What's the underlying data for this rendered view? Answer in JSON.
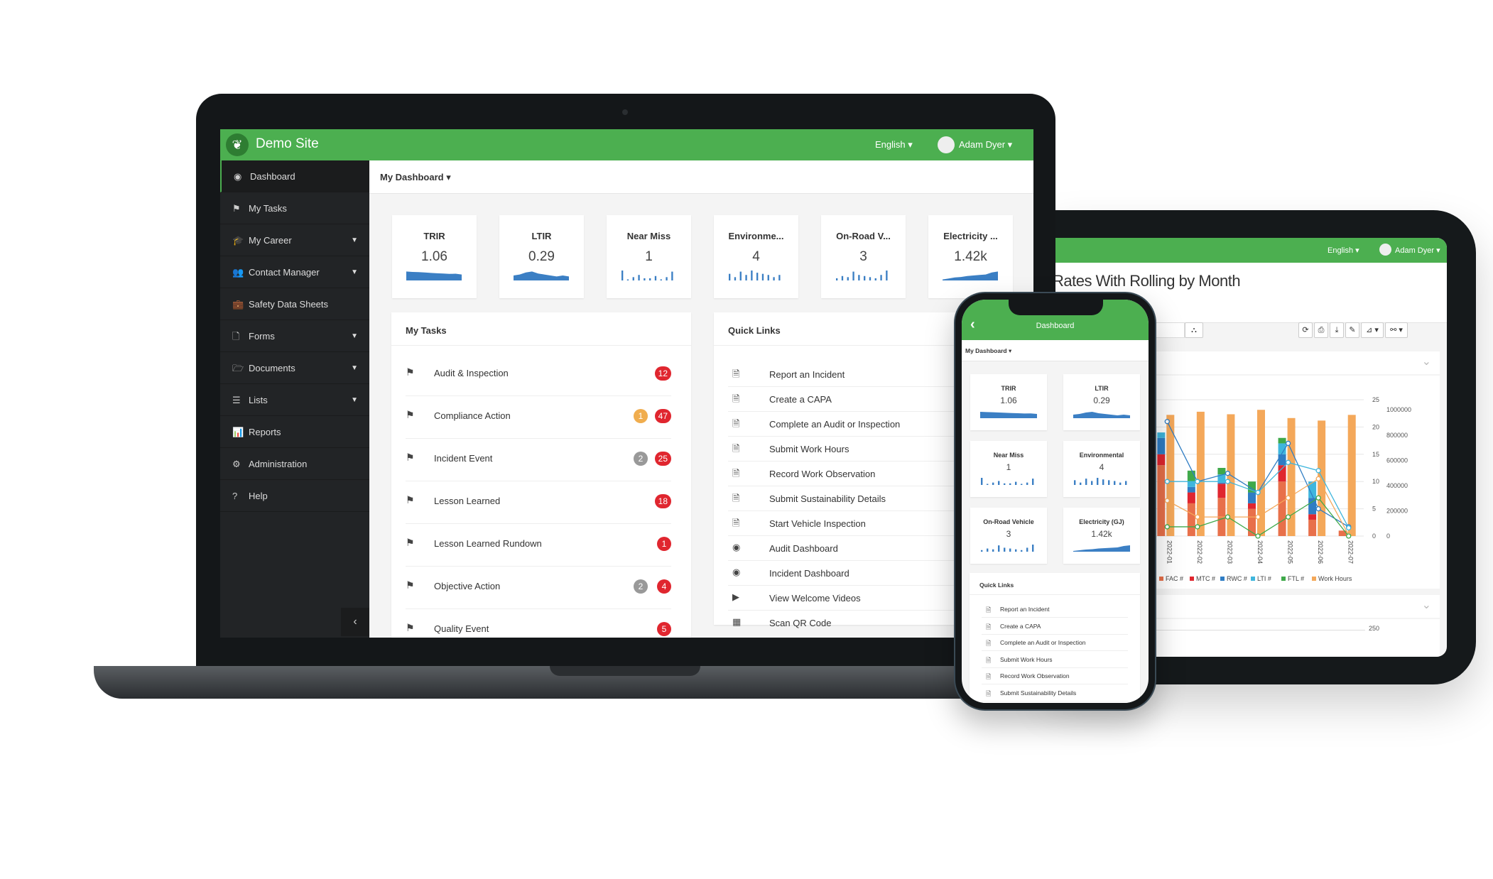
{
  "site": {
    "name": "Demo Site",
    "language": "English",
    "user": "Adam Dyer"
  },
  "sidebar": {
    "items": [
      {
        "label": "Dashboard",
        "icon": "dashboard-icon",
        "glyph": "◉",
        "caret": false
      },
      {
        "label": "My Tasks",
        "icon": "flag-icon",
        "glyph": "⚑",
        "caret": false
      },
      {
        "label": "My Career",
        "icon": "graduation-cap-icon",
        "glyph": "🎓",
        "caret": true
      },
      {
        "label": "Contact Manager",
        "icon": "users-icon",
        "glyph": "👥",
        "caret": true
      },
      {
        "label": "Safety Data Sheets",
        "icon": "briefcase-icon",
        "glyph": "💼",
        "caret": false
      },
      {
        "label": "Forms",
        "icon": "file-icon",
        "glyph": "🗋",
        "caret": true
      },
      {
        "label": "Documents",
        "icon": "folder-icon",
        "glyph": "🗁",
        "caret": true
      },
      {
        "label": "Lists",
        "icon": "list-icon",
        "glyph": "☰",
        "caret": true
      },
      {
        "label": "Reports",
        "icon": "bar-chart-icon",
        "glyph": "📊",
        "caret": false
      },
      {
        "label": "Administration",
        "icon": "gear-icon",
        "glyph": "⚙",
        "caret": false
      },
      {
        "label": "Help",
        "icon": "question-icon",
        "glyph": "?",
        "caret": false
      }
    ],
    "collapse_glyph": "‹"
  },
  "dashboard_selector": "My Dashboard",
  "kpis": [
    {
      "title": "TRIR",
      "full": "TRIR",
      "value": "1.06",
      "type": "area",
      "spark": [
        9,
        8.6,
        8.4,
        8,
        7.6,
        7.2,
        7,
        6.6,
        6.8,
        6
      ]
    },
    {
      "title": "LTIR",
      "full": "LTIR",
      "value": "0.29",
      "type": "area",
      "spark": [
        5,
        6,
        8,
        9,
        7,
        6,
        5,
        4,
        5,
        4
      ]
    },
    {
      "title": "Near Miss",
      "full": "Near Miss",
      "value": "1",
      "type": "bars",
      "spark": [
        9,
        0,
        3,
        5,
        2,
        2,
        4,
        1,
        3,
        8
      ]
    },
    {
      "title": "Environme...",
      "full": "Environmental",
      "value": "4",
      "type": "bars",
      "spark": [
        6,
        3,
        8,
        5,
        9,
        7,
        6,
        5,
        3,
        5
      ]
    },
    {
      "title": "On-Road V...",
      "full": "On-Road Vehicle",
      "value": "3",
      "type": "bars",
      "spark": [
        2,
        4,
        3,
        8,
        5,
        4,
        3,
        2,
        5,
        9
      ]
    },
    {
      "title": "Electricity ...",
      "full": "Electricity (GJ)",
      "value": "1.42k",
      "type": "area",
      "spark": [
        1,
        2,
        3,
        3.5,
        4.5,
        5,
        5.5,
        6,
        8,
        9
      ]
    }
  ],
  "my_tasks": {
    "title": "My Tasks",
    "items": [
      {
        "label": "Audit & Inspection",
        "badges": [
          {
            "n": "12",
            "c": "#e0262f"
          }
        ]
      },
      {
        "label": "Compliance Action",
        "badges": [
          {
            "n": "1",
            "c": "#f0ad4e"
          },
          {
            "n": "47",
            "c": "#e0262f"
          }
        ]
      },
      {
        "label": "Incident Event",
        "badges": [
          {
            "n": "2",
            "c": "#999999"
          },
          {
            "n": "25",
            "c": "#e0262f"
          }
        ]
      },
      {
        "label": "Lesson Learned",
        "badges": [
          {
            "n": "18",
            "c": "#e0262f"
          }
        ]
      },
      {
        "label": "Lesson Learned Rundown",
        "badges": [
          {
            "n": "1",
            "c": "#e0262f"
          }
        ]
      },
      {
        "label": "Objective Action",
        "badges": [
          {
            "n": "2",
            "c": "#999999"
          },
          {
            "n": "4",
            "c": "#e0262f"
          }
        ]
      },
      {
        "label": "Quality Event",
        "badges": [
          {
            "n": "5",
            "c": "#e0262f"
          }
        ]
      }
    ]
  },
  "quick_links": {
    "title": "Quick Links",
    "items": [
      {
        "label": "Report an Incident",
        "icon": "file-text-icon",
        "glyph": "🗎"
      },
      {
        "label": "Create a CAPA",
        "icon": "file-text-icon",
        "glyph": "🗎"
      },
      {
        "label": "Complete an Audit or Inspection",
        "icon": "file-text-icon",
        "glyph": "🗎"
      },
      {
        "label": "Submit Work Hours",
        "icon": "file-text-icon",
        "glyph": "🗎"
      },
      {
        "label": "Record Work Observation",
        "icon": "file-text-icon",
        "glyph": "🗎"
      },
      {
        "label": "Submit Sustainability Details",
        "icon": "file-text-icon",
        "glyph": "🗎"
      },
      {
        "label": "Start Vehicle Inspection",
        "icon": "file-text-icon",
        "glyph": "🗎"
      },
      {
        "label": "Audit Dashboard",
        "icon": "dashboard-icon",
        "glyph": "◉"
      },
      {
        "label": "Incident Dashboard",
        "icon": "dashboard-icon",
        "glyph": "◉"
      },
      {
        "label": "View Welcome Videos",
        "icon": "video-icon",
        "glyph": "▶"
      },
      {
        "label": "Scan QR Code",
        "icon": "qr-code-icon",
        "glyph": "▦"
      }
    ]
  },
  "phone": {
    "title": "Dashboard",
    "back_glyph": "‹"
  },
  "tablet": {
    "report_title": "Rates With Rolling by Month",
    "toolbar": [
      {
        "name": "refresh-button",
        "glyph": "⟳"
      },
      {
        "name": "print-button",
        "glyph": "⎙"
      },
      {
        "name": "download-button",
        "glyph": "⤓"
      },
      {
        "name": "edit-button",
        "glyph": "✎"
      },
      {
        "name": "rss-button",
        "glyph": "⊿ ▾"
      },
      {
        "name": "link-button",
        "glyph": "⚯ ▾"
      }
    ],
    "hierarchy_glyph": "⛬",
    "collapse_glyph": "⌄",
    "next_axis_tick": "250"
  },
  "colors": {
    "green": "#4caf50",
    "sidebar": "#222426",
    "spark": "#3b7fc4"
  },
  "chart_data": {
    "type": "bar",
    "title": "Rates With Rolling by Month",
    "categories": [
      "2022-01",
      "2022-02",
      "2022-03",
      "2022-04",
      "2022-05",
      "2022-06",
      "2022-07"
    ],
    "y_left": {
      "range": [
        0,
        25
      ],
      "ticks": [
        "0",
        "5",
        "10",
        "15",
        "20",
        "25"
      ]
    },
    "y_right": {
      "range": [
        0,
        1080000
      ],
      "ticks": [
        "0",
        "200000",
        "400000",
        "600000",
        "800000",
        "1000000"
      ]
    },
    "stacked_series": [
      {
        "name": "FAC #",
        "color": "#e8704a",
        "values": [
          13,
          6,
          7,
          5,
          10,
          3,
          1
        ]
      },
      {
        "name": "MTC #",
        "color": "#e0262f",
        "values": [
          2,
          2,
          2.6,
          1,
          3,
          1,
          0
        ]
      },
      {
        "name": "RWC #",
        "color": "#2f7dc4",
        "values": [
          3,
          1,
          0.2,
          2,
          2,
          3,
          0
        ]
      },
      {
        "name": "LTI #",
        "color": "#3fb6dd",
        "values": [
          1,
          1,
          1.5,
          0,
          2,
          3,
          0
        ]
      },
      {
        "name": "FTL #",
        "color": "#3fa94a",
        "values": [
          0,
          2,
          1.2,
          2,
          1,
          0,
          0
        ]
      }
    ],
    "bar_series": {
      "name": "Work Hours",
      "color": "#f4a85a",
      "axis": "right",
      "values": [
        960000,
        985000,
        965000,
        1000000,
        935000,
        915000,
        960000
      ]
    },
    "line_series": [
      {
        "color": "#2f7dc4",
        "values": [
          21,
          10,
          11.5,
          8,
          17,
          5,
          1.7
        ]
      },
      {
        "color": "#3fb6dd",
        "values": [
          10,
          10,
          10,
          8,
          13.5,
          12,
          1.5
        ]
      },
      {
        "color": "#f4a85a",
        "values": [
          6.5,
          3.5,
          3.5,
          3.5,
          7,
          10.5,
          0.2
        ]
      },
      {
        "color": "#3fa94a",
        "values": [
          1.7,
          1.7,
          3.5,
          0,
          3.5,
          7,
          0
        ]
      }
    ],
    "legend": "bottom",
    "grid": true
  }
}
